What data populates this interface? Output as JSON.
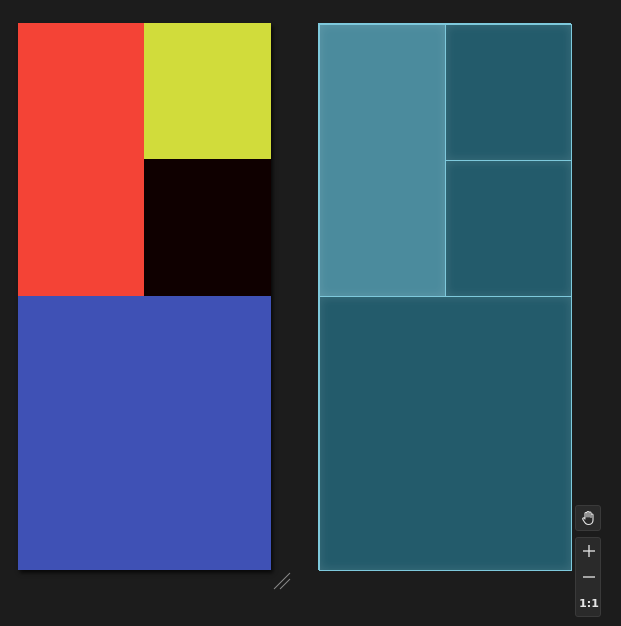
{
  "preview": {
    "blocks": [
      {
        "name": "red",
        "color": "#f44336"
      },
      {
        "name": "yellow",
        "color": "#d1dc3b"
      },
      {
        "name": "black",
        "color": "#0f0000"
      },
      {
        "name": "blue",
        "color": "#3f51b5"
      }
    ]
  },
  "layout_view": {
    "colors": {
      "highlight": "#4b8b9d",
      "cell": "#235b6b",
      "outline": "#7ec9dc"
    }
  },
  "toolbar": {
    "pan_icon": "hand-icon",
    "zoom_in_icon": "plus-icon",
    "zoom_out_icon": "minus-icon",
    "actual_size_label": "1:1"
  }
}
